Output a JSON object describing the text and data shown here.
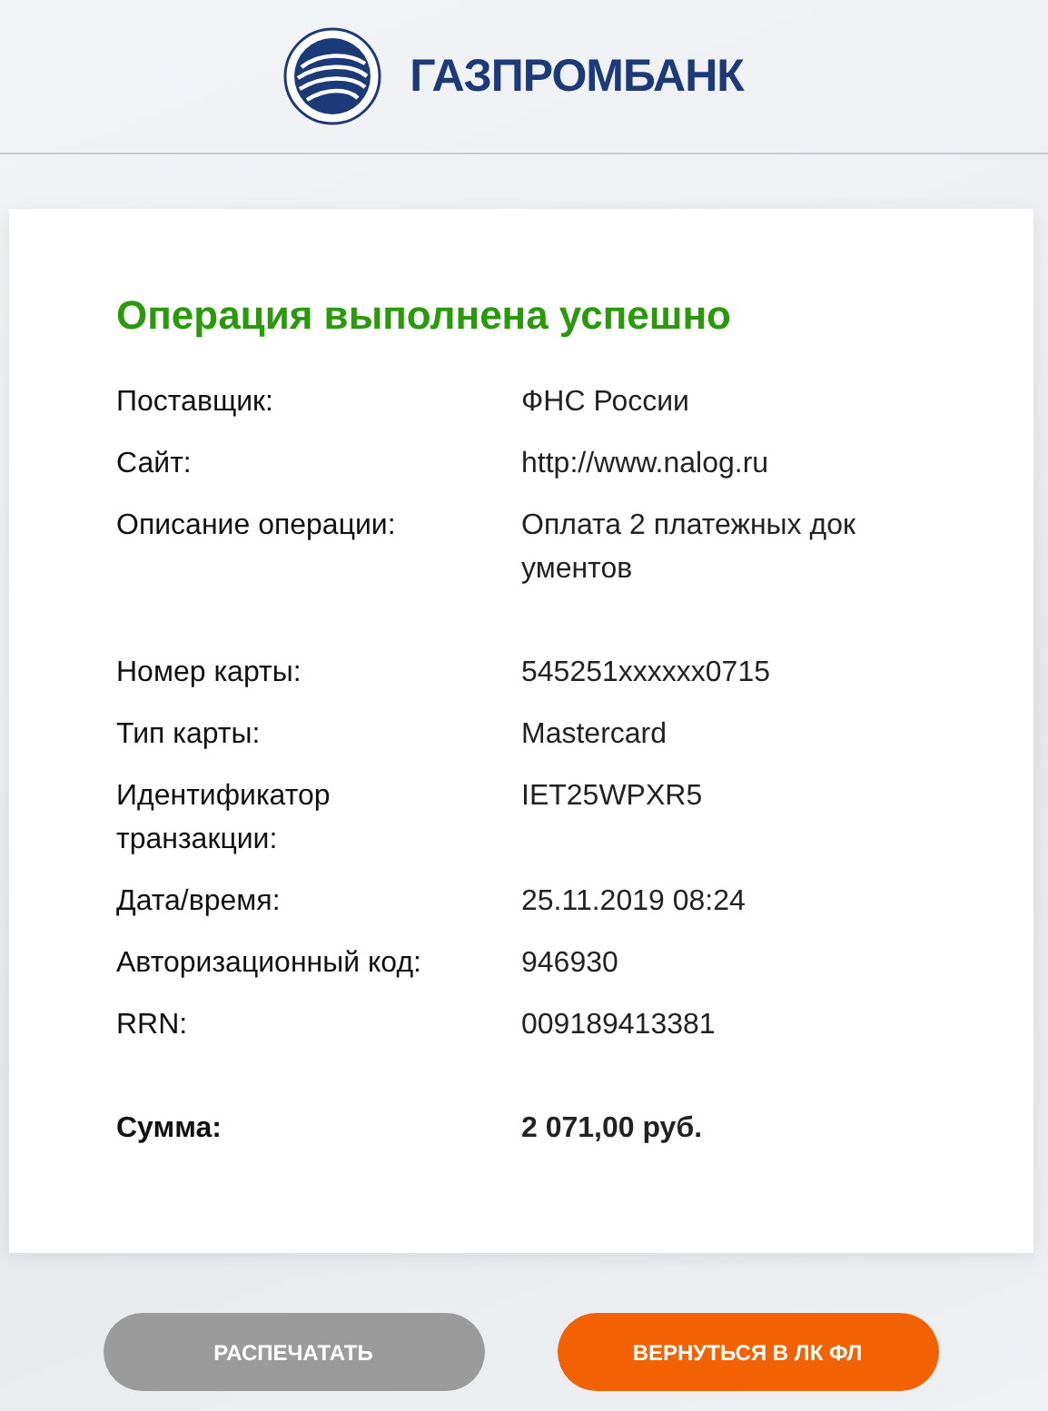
{
  "header": {
    "logo_text": "ГАЗПРОМБАНК"
  },
  "receipt": {
    "title": "Операция выполнена успешно",
    "sections": [
      {
        "rows": [
          {
            "label": "Поставщик:",
            "value": "ФНС России",
            "kind": "field"
          },
          {
            "label": "Сайт:",
            "value": "http://www.nalog.ru",
            "kind": "field"
          },
          {
            "label": "Описание операции:",
            "value": "Оплата 2 платежных док ументов",
            "kind": "field"
          }
        ]
      },
      {
        "rows": [
          {
            "label": "Номер карты:",
            "value": "545251xxxxxx0715",
            "kind": "field"
          },
          {
            "label": "Тип карты:",
            "value": "Mastercard",
            "kind": "field"
          },
          {
            "label": "Идентификатор транзакции:",
            "value": "IET25WPXR5",
            "kind": "field"
          },
          {
            "label": "Дата/время:",
            "value": "25.11.2019 08:24",
            "kind": "field"
          },
          {
            "label": "Авторизационный код:",
            "value": "946930",
            "kind": "field"
          },
          {
            "label": "RRN:",
            "value": "009189413381",
            "kind": "field"
          }
        ]
      },
      {
        "rows": [
          {
            "label": "Сумма:",
            "value": "2 071,00 руб.",
            "kind": "total"
          }
        ]
      }
    ]
  },
  "buttons": [
    {
      "label": "РАСПЕЧАТАТЬ",
      "kind": "secondary"
    },
    {
      "label": "ВЕРНУТЬСЯ В ЛК ФЛ",
      "kind": "primary"
    }
  ]
}
